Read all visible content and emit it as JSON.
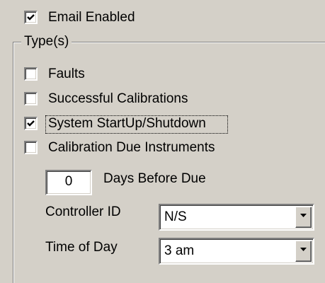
{
  "email_enabled": {
    "label": "Email Enabled",
    "checked": true
  },
  "types_group": {
    "title": "Type(s)",
    "options": [
      {
        "label": "Faults",
        "checked": false
      },
      {
        "label": "Successful Calibrations",
        "checked": false
      },
      {
        "label": "System StartUp/Shutdown",
        "checked": true
      },
      {
        "label": "Calibration Due Instruments",
        "checked": false
      }
    ]
  },
  "days_before_due": {
    "value": "0",
    "label": "Days Before Due"
  },
  "controller_id": {
    "label": "Controller ID",
    "value": "N/S"
  },
  "time_of_day": {
    "label": "Time of Day",
    "value": "3 am"
  },
  "icons": {
    "check": "checkmark-icon",
    "dropdown": "chevron-down-icon"
  }
}
